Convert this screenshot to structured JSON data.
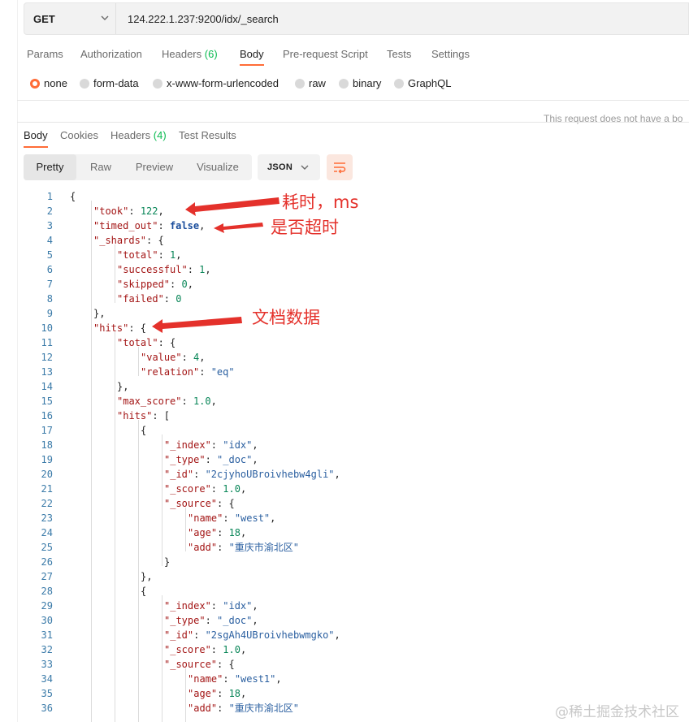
{
  "request": {
    "method": "GET",
    "url": "124.222.1.237:9200/idx/_search"
  },
  "request_tabs": [
    {
      "label": "Params"
    },
    {
      "label": "Authorization"
    },
    {
      "label": "Headers",
      "count": "(6)"
    },
    {
      "label": "Body"
    },
    {
      "label": "Pre-request Script"
    },
    {
      "label": "Tests"
    },
    {
      "label": "Settings"
    }
  ],
  "body_types": [
    {
      "label": "none",
      "selected": true
    },
    {
      "label": "form-data",
      "selected": false
    },
    {
      "label": "x-www-form-urlencoded",
      "selected": false
    },
    {
      "label": "raw",
      "selected": false
    },
    {
      "label": "binary",
      "selected": false
    },
    {
      "label": "GraphQL",
      "selected": false
    }
  ],
  "body_hint": "This request does not have a bo",
  "response_tabs": [
    {
      "label": "Body"
    },
    {
      "label": "Cookies"
    },
    {
      "label": "Headers",
      "count": "(4)"
    },
    {
      "label": "Test Results"
    }
  ],
  "view_modes": [
    "Pretty",
    "Raw",
    "Preview",
    "Visualize"
  ],
  "format": "JSON",
  "code_lines": [
    [
      [
        "p",
        "{"
      ]
    ],
    [
      [
        "k",
        "\"took\""
      ],
      [
        "p",
        ": "
      ],
      [
        "n",
        "122"
      ],
      [
        "p",
        ","
      ]
    ],
    [
      [
        "k",
        "\"timed_out\""
      ],
      [
        "p",
        ": "
      ],
      [
        "b",
        "false"
      ],
      [
        "p",
        ","
      ]
    ],
    [
      [
        "k",
        "\"_shards\""
      ],
      [
        "p",
        ": {"
      ]
    ],
    [
      [
        "k",
        "\"total\""
      ],
      [
        "p",
        ": "
      ],
      [
        "n",
        "1"
      ],
      [
        "p",
        ","
      ]
    ],
    [
      [
        "k",
        "\"successful\""
      ],
      [
        "p",
        ": "
      ],
      [
        "n",
        "1"
      ],
      [
        "p",
        ","
      ]
    ],
    [
      [
        "k",
        "\"skipped\""
      ],
      [
        "p",
        ": "
      ],
      [
        "n",
        "0"
      ],
      [
        "p",
        ","
      ]
    ],
    [
      [
        "k",
        "\"failed\""
      ],
      [
        "p",
        ": "
      ],
      [
        "n",
        "0"
      ]
    ],
    [
      [
        "p",
        "},"
      ]
    ],
    [
      [
        "k",
        "\"hits\""
      ],
      [
        "p",
        ": {"
      ]
    ],
    [
      [
        "k",
        "\"total\""
      ],
      [
        "p",
        ": {"
      ]
    ],
    [
      [
        "k",
        "\"value\""
      ],
      [
        "p",
        ": "
      ],
      [
        "n",
        "4"
      ],
      [
        "p",
        ","
      ]
    ],
    [
      [
        "k",
        "\"relation\""
      ],
      [
        "p",
        ": "
      ],
      [
        "s",
        "\"eq\""
      ]
    ],
    [
      [
        "p",
        "},"
      ]
    ],
    [
      [
        "k",
        "\"max_score\""
      ],
      [
        "p",
        ": "
      ],
      [
        "n",
        "1.0"
      ],
      [
        "p",
        ","
      ]
    ],
    [
      [
        "k",
        "\"hits\""
      ],
      [
        "p",
        ": ["
      ]
    ],
    [
      [
        "p",
        "{"
      ]
    ],
    [
      [
        "k",
        "\"_index\""
      ],
      [
        "p",
        ": "
      ],
      [
        "s",
        "\"idx\""
      ],
      [
        "p",
        ","
      ]
    ],
    [
      [
        "k",
        "\"_type\""
      ],
      [
        "p",
        ": "
      ],
      [
        "s",
        "\"_doc\""
      ],
      [
        "p",
        ","
      ]
    ],
    [
      [
        "k",
        "\"_id\""
      ],
      [
        "p",
        ": "
      ],
      [
        "s",
        "\"2cjyhoUBroivhebw4gli\""
      ],
      [
        "p",
        ","
      ]
    ],
    [
      [
        "k",
        "\"_score\""
      ],
      [
        "p",
        ": "
      ],
      [
        "n",
        "1.0"
      ],
      [
        "p",
        ","
      ]
    ],
    [
      [
        "k",
        "\"_source\""
      ],
      [
        "p",
        ": {"
      ]
    ],
    [
      [
        "k",
        "\"name\""
      ],
      [
        "p",
        ": "
      ],
      [
        "s",
        "\"west\""
      ],
      [
        "p",
        ","
      ]
    ],
    [
      [
        "k",
        "\"age\""
      ],
      [
        "p",
        ": "
      ],
      [
        "n",
        "18"
      ],
      [
        "p",
        ","
      ]
    ],
    [
      [
        "k",
        "\"add\""
      ],
      [
        "p",
        ": "
      ],
      [
        "s",
        "\"重庆市渝北区\""
      ]
    ],
    [
      [
        "p",
        "}"
      ]
    ],
    [
      [
        "p",
        "},"
      ]
    ],
    [
      [
        "p",
        "{"
      ]
    ],
    [
      [
        "k",
        "\"_index\""
      ],
      [
        "p",
        ": "
      ],
      [
        "s",
        "\"idx\""
      ],
      [
        "p",
        ","
      ]
    ],
    [
      [
        "k",
        "\"_type\""
      ],
      [
        "p",
        ": "
      ],
      [
        "s",
        "\"_doc\""
      ],
      [
        "p",
        ","
      ]
    ],
    [
      [
        "k",
        "\"_id\""
      ],
      [
        "p",
        ": "
      ],
      [
        "s",
        "\"2sgAh4UBroivhebwmgko\""
      ],
      [
        "p",
        ","
      ]
    ],
    [
      [
        "k",
        "\"_score\""
      ],
      [
        "p",
        ": "
      ],
      [
        "n",
        "1.0"
      ],
      [
        "p",
        ","
      ]
    ],
    [
      [
        "k",
        "\"_source\""
      ],
      [
        "p",
        ": {"
      ]
    ],
    [
      [
        "k",
        "\"name\""
      ],
      [
        "p",
        ": "
      ],
      [
        "s",
        "\"west1\""
      ],
      [
        "p",
        ","
      ]
    ],
    [
      [
        "k",
        "\"age\""
      ],
      [
        "p",
        ": "
      ],
      [
        "n",
        "18"
      ],
      [
        "p",
        ","
      ]
    ],
    [
      [
        "k",
        "\"add\""
      ],
      [
        "p",
        ": "
      ],
      [
        "s",
        "\"重庆市渝北区\""
      ]
    ]
  ],
  "annotations": {
    "took": "耗时，ms",
    "timed_out": "是否超时",
    "hits": "文档数据",
    "color": "#e4312b"
  },
  "watermark": "@稀土掘金技术社区",
  "colors": {
    "accent": "#ff6c37",
    "count_green": "#0cbb52"
  }
}
